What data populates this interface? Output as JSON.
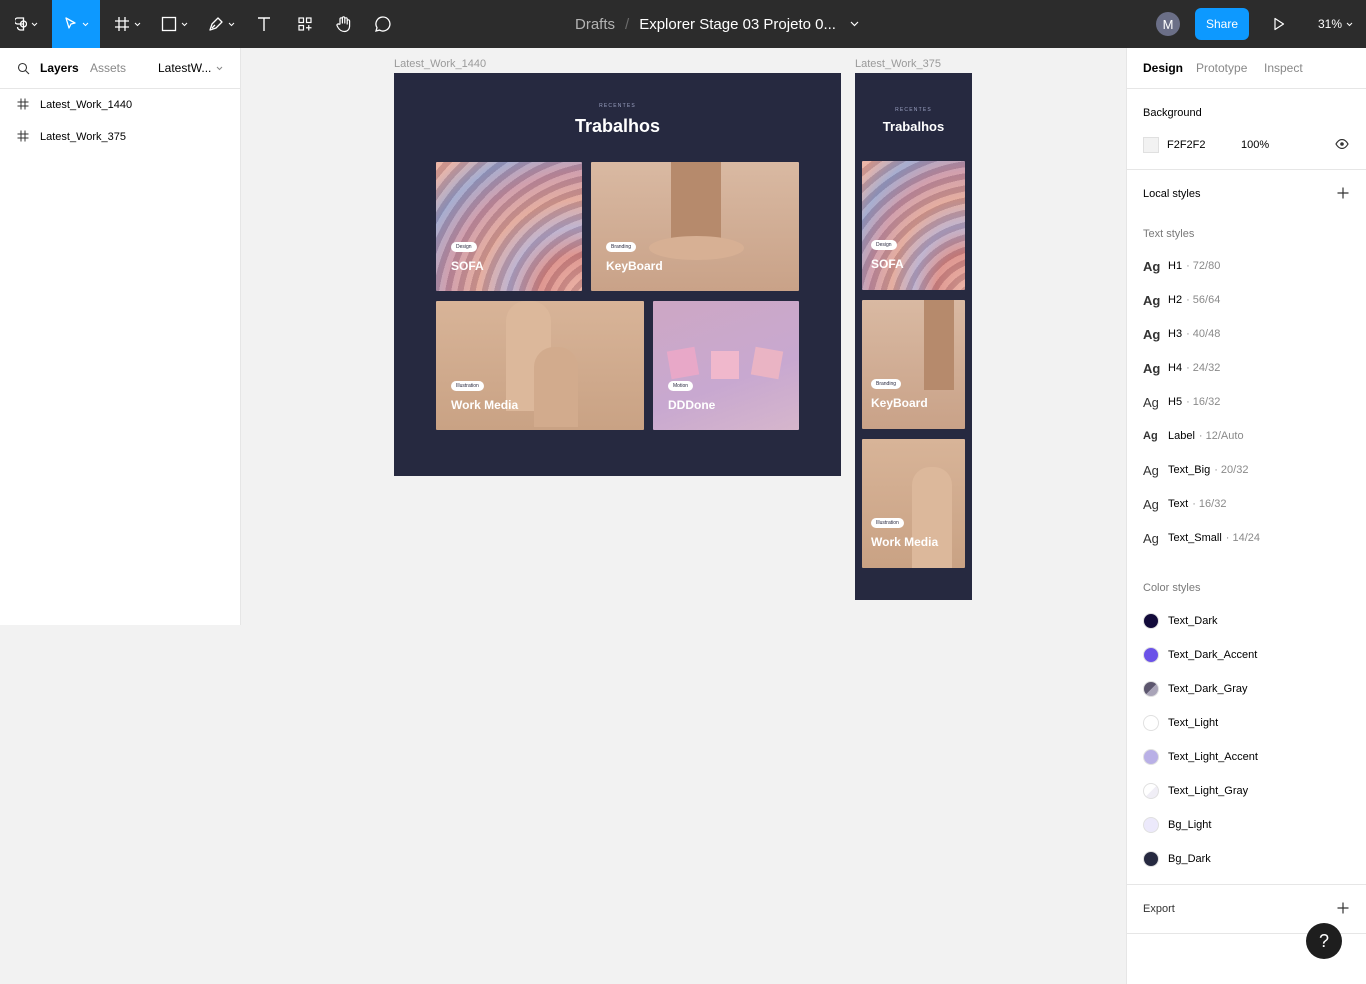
{
  "toolbar": {
    "breadcrumb_root": "Drafts",
    "breadcrumb_sep": "/",
    "file_name": "Explorer Stage 03 Projeto 0...",
    "avatar_initial": "M",
    "share_label": "Share",
    "zoom": "31%"
  },
  "left_panel": {
    "tabs": [
      "Layers",
      "Assets"
    ],
    "page_selector": "LatestW...",
    "layers": [
      "Latest_Work_1440",
      "Latest_Work_375"
    ]
  },
  "canvas": {
    "desktop": {
      "label": "Latest_Work_1440",
      "overline": "RECENTES",
      "title": "Trabalhos",
      "cards": [
        {
          "tag": "Design",
          "name": "SOFA"
        },
        {
          "tag": "Branding",
          "name": "KeyBoard"
        },
        {
          "tag": "Illustration",
          "name": "Work Media"
        },
        {
          "tag": "Motion",
          "name": "DDDone"
        }
      ]
    },
    "mobile": {
      "label": "Latest_Work_375",
      "overline": "RECENTES",
      "title": "Trabalhos",
      "cards": [
        {
          "tag": "Design",
          "name": "SOFA"
        },
        {
          "tag": "Branding",
          "name": "KeyBoard"
        },
        {
          "tag": "Illustration",
          "name": "Work Media"
        }
      ]
    },
    "frame_bg": "#262940"
  },
  "right_panel": {
    "tabs": [
      "Design",
      "Prototype",
      "Inspect"
    ],
    "background": {
      "title": "Background",
      "color": "F2F2F2",
      "opacity": "100%"
    },
    "local_styles_title": "Local styles",
    "text_styles_title": "Text styles",
    "text_styles": [
      {
        "name": "H1",
        "desc": "· 72/80"
      },
      {
        "name": "H2",
        "desc": "· 56/64"
      },
      {
        "name": "H3",
        "desc": "· 40/48"
      },
      {
        "name": "H4",
        "desc": "· 24/32"
      },
      {
        "name": "H5",
        "desc": "· 16/32"
      },
      {
        "name": "Label",
        "desc": "· 12/Auto"
      },
      {
        "name": "Text_Big",
        "desc": "· 20/32"
      },
      {
        "name": "Text",
        "desc": "· 16/32"
      },
      {
        "name": "Text_Small",
        "desc": "· 14/24"
      }
    ],
    "color_styles_title": "Color styles",
    "color_styles": [
      {
        "name": "Text_Dark",
        "color": "#120a3a"
      },
      {
        "name": "Text_Dark_Accent",
        "color": "#6b52e8"
      },
      {
        "name": "Text_Dark_Gray",
        "color": "#7e7a90"
      },
      {
        "name": "Text_Light",
        "color": "#ffffff"
      },
      {
        "name": "Text_Light_Accent",
        "color": "#b9b0e6"
      },
      {
        "name": "Text_Light_Gray",
        "color": "#f4f2fa"
      },
      {
        "name": "Bg_Light",
        "color": "#ece9fb"
      },
      {
        "name": "Bg_Dark",
        "color": "#262940"
      }
    ],
    "export_title": "Export"
  },
  "help_label": "?"
}
